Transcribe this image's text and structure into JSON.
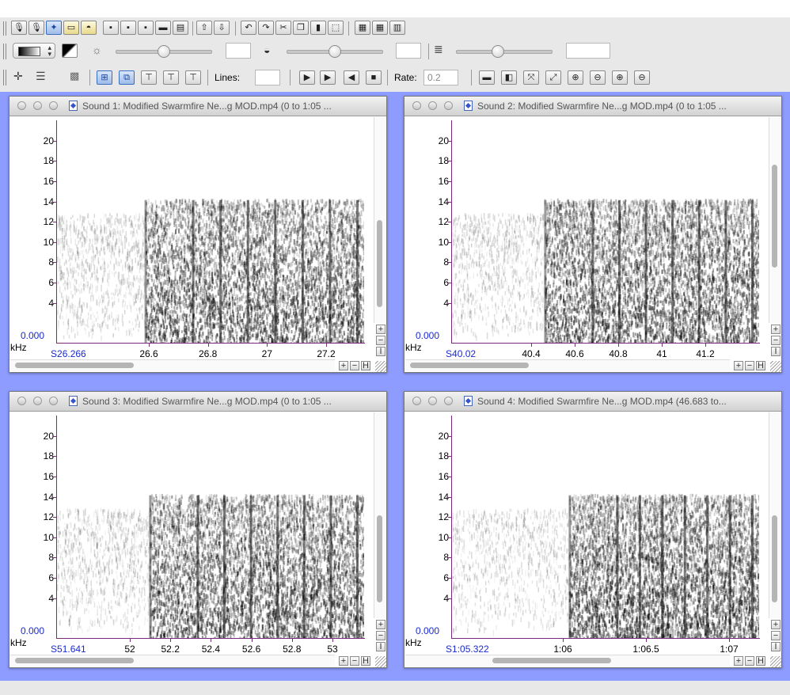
{
  "toolbar": {
    "row1_icons": [
      "record-icon",
      "record-options-icon",
      "new-sound-icon",
      "open-icon",
      "save-icon",
      "cut-window-icon",
      "copy-window-icon",
      "paste-window-icon",
      "print-icon",
      "page-setup-icon",
      "import-icon",
      "export-icon",
      "undo-icon",
      "redo-icon",
      "cut-icon",
      "copy-icon",
      "paste-icon",
      "select-all-icon",
      "layout-a-icon",
      "layout-b-icon",
      "layout-c-icon"
    ],
    "brightness_value": "",
    "contrast_value": "",
    "volume_value": "",
    "lines_label": "Lines:",
    "lines_value": "",
    "rate_label": "Rate:",
    "rate_value": "0.2",
    "brightness_pos": 0.5,
    "contrast_pos": 0.5,
    "volume_pos": 0.5
  },
  "windows": [
    {
      "title": "Sound 1: Modified Swarmfire Ne...g MOD.mp4 (0 to 1:05 ...",
      "y_labels": [
        "20",
        "18",
        "16",
        "14",
        "12",
        "10",
        "8",
        "6",
        "4"
      ],
      "y_zero": "0.000",
      "y_unit": "kHz",
      "x_start": "26.266",
      "x_labels": [
        "26.6",
        "26.8",
        "27",
        "27.2"
      ],
      "onset": 0.285
    },
    {
      "title": "Sound 2: Modified Swarmfire Ne...g MOD.mp4 (0 to 1:05 ...",
      "y_labels": [
        "20",
        "18",
        "16",
        "14",
        "12",
        "10",
        "8",
        "6",
        "4"
      ],
      "y_zero": "0.000",
      "y_unit": "kHz",
      "x_start": "40.02",
      "x_labels": [
        "40.4",
        "40.6",
        "40.8",
        "41",
        "41.2"
      ],
      "onset": 0.3
    },
    {
      "title": "Sound 3: Modified Swarmfire Ne...g MOD.mp4 (0 to 1:05 ...",
      "y_labels": [
        "20",
        "18",
        "16",
        "14",
        "12",
        "10",
        "8",
        "6",
        "4"
      ],
      "y_zero": "0.000",
      "y_unit": "kHz",
      "x_start": "51.641",
      "x_labels": [
        "52",
        "52.2",
        "52.4",
        "52.6",
        "52.8",
        "53"
      ],
      "onset": 0.3
    },
    {
      "title": "Sound 4: Modified Swarmfire Ne...g MOD.mp4 (46.683 to...",
      "y_labels": [
        "20",
        "18",
        "16",
        "14",
        "12",
        "10",
        "8",
        "6",
        "4"
      ],
      "y_zero": "0.000",
      "y_unit": "kHz",
      "x_start": "1:05.322",
      "x_labels": [
        "1:06",
        "1:06.5",
        "1:07"
      ],
      "onset": 0.38
    }
  ]
}
